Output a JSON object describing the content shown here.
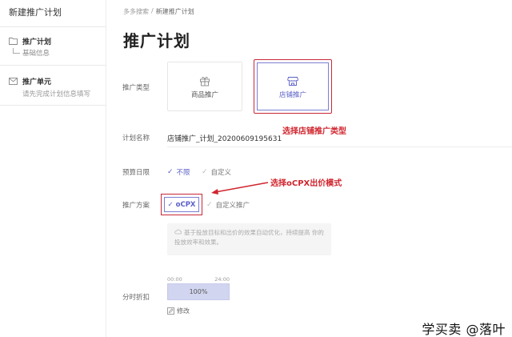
{
  "sidebar": {
    "title": "新建推广计划",
    "plan": {
      "label": "推广计划",
      "sub": "基础信息",
      "icon": "folder-icon"
    },
    "unit": {
      "label": "推广单元",
      "hint": "请先完成计划信息填写",
      "icon": "mail-icon"
    }
  },
  "breadcrumb": {
    "root": "多多搜索",
    "sep": "/",
    "current": "新建推广计划"
  },
  "page_title": "推广计划",
  "form": {
    "type_label": "推广类型",
    "type_options": [
      {
        "label": "商品推广",
        "icon": "gift-icon"
      },
      {
        "label": "店铺推广",
        "icon": "store-icon",
        "selected": true
      }
    ],
    "name_label": "计划名称",
    "name_value": "店铺推广_计划_20200609195631",
    "budget_label": "预算日限",
    "budget_options": [
      "不限",
      "自定义"
    ],
    "scheme_label": "推广方案",
    "scheme_options": [
      "oCPX",
      "自定义推广"
    ],
    "scheme_info": "基于投放目标和出价的效果自动优化，持续提高 你的投放效率和效果。",
    "discount_label": "分时折扣",
    "time_start": "00:00",
    "time_end": "24:00",
    "time_percent": "100%",
    "edit_label": "修改"
  },
  "annotations": {
    "shop_type": "选择店铺推广类型",
    "ocpx": "选择oCPX出价模式"
  },
  "watermark": "学买卖 @落叶",
  "colors": {
    "accent": "#5a5fc6",
    "annotation_red": "#d0252e"
  }
}
